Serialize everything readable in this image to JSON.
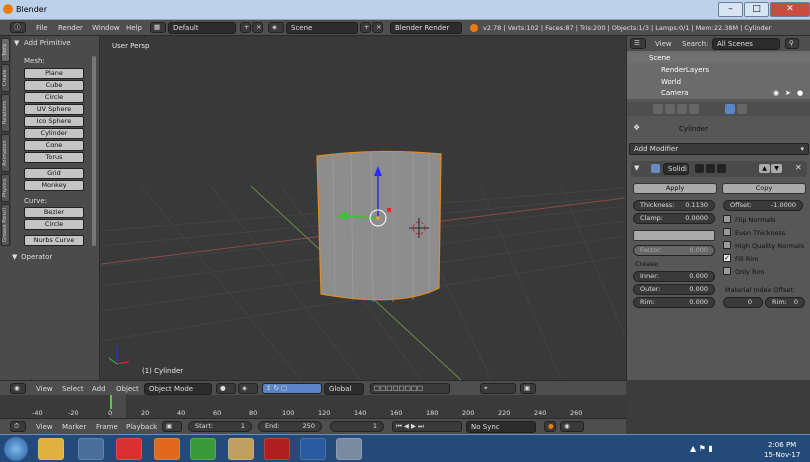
{
  "window": {
    "title": "Blender"
  },
  "info_bar": {
    "menus": [
      "File",
      "Render",
      "Window",
      "Help"
    ],
    "screen": "Default",
    "scene": "Scene",
    "engine": "Blender Render",
    "stats": "v2.78 | Verts:102 | Faces:87 | Tris:200 | Objects:1/3 | Lamps:0/1 | Mem:22.38M | Cylinder"
  },
  "tool_shelf": {
    "tabs": [
      "Tools",
      "Create",
      "Relations",
      "Animation",
      "Physics",
      "Grease Pencil"
    ],
    "panel_title": "Add Primitive",
    "mesh_label": "Mesh:",
    "mesh_items": [
      "Plane",
      "Cube",
      "Circle",
      "UV Sphere",
      "Ico Sphere",
      "Cylinder",
      "Cone",
      "Torus",
      "Grid",
      "Monkey"
    ],
    "curve_label": "Curve:",
    "curve_items": [
      "Bezier",
      "Circle",
      "Nurbs Curve"
    ],
    "operator": "Operator"
  },
  "viewport": {
    "view_name": "User Persp",
    "object_label": "(1) Cylinder"
  },
  "viewport_header": {
    "menus": [
      "View",
      "Select",
      "Add",
      "Object"
    ],
    "mode": "Object Mode",
    "orientation": "Global"
  },
  "timeline": {
    "ticks": [
      "-40",
      "-20",
      "0",
      "20",
      "40",
      "60",
      "80",
      "100",
      "120",
      "140",
      "160",
      "180",
      "200",
      "220",
      "240",
      "260"
    ],
    "current_frame": "0"
  },
  "timeline_header": {
    "menus": [
      "View",
      "Marker",
      "Frame",
      "Playback"
    ],
    "start_label": "Start:",
    "start_value": "1",
    "end_label": "End:",
    "end_value": "250",
    "current": "1",
    "sync": "No Sync"
  },
  "outliner": {
    "menus": [
      "View",
      "Search:"
    ],
    "filter": "All Scenes",
    "items": [
      "Scene",
      "RenderLayers",
      "World",
      "Camera"
    ]
  },
  "properties": {
    "breadcrumb": "Cylinder",
    "add_modifier": "Add Modifier",
    "modifier_name": "Solidi",
    "apply": "Apply",
    "copy": "Copy",
    "thickness_label": "Thickness:",
    "thickness_value": "0.1130",
    "offset_label": "Offset:",
    "offset_value": "-1.0000",
    "clamp_label": "Clamp:",
    "clamp_value": "0.0000",
    "factor_label": "Factor:",
    "factor_value": "0.000",
    "crease_label": "Crease:",
    "inner_label": "Inner:",
    "inner_value": "0.000",
    "outer_label": "Outer:",
    "outer_value": "0.000",
    "rim_label": "Rim:",
    "rim_value": "0.000",
    "flip_normals": "Flip Normals",
    "even_thickness": "Even Thickness",
    "high_quality_normals": "High Quality Normals",
    "fill_rim": "Fill Rim",
    "only_rim": "Only Rim",
    "material_index_offset": "Material Index Offset:",
    "mat_value": "0",
    "rim_mat_label": "Rim:",
    "rim_mat_value": "0"
  },
  "taskbar": {
    "time": "2:06 PM",
    "date": "15-Nov-17"
  }
}
